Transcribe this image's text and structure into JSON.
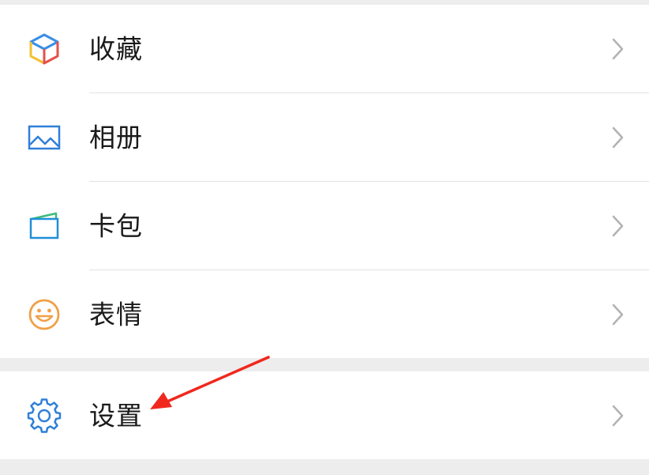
{
  "menu": {
    "items": [
      {
        "label": "收藏",
        "icon": "favorites-cube-icon"
      },
      {
        "label": "相册",
        "icon": "album-picture-icon"
      },
      {
        "label": "卡包",
        "icon": "card-wallet-icon"
      },
      {
        "label": "表情",
        "icon": "smiley-face-icon"
      }
    ],
    "settings": {
      "label": "设置",
      "icon": "gear-icon"
    }
  },
  "colors": {
    "background": "#ededed",
    "row": "#ffffff",
    "album_blue": "#2f7fd8",
    "smile_orange": "#f0a048",
    "settings_blue": "#2f7fd8",
    "annotation_red": "#f0281e",
    "chevron": "#b2b2b2"
  }
}
